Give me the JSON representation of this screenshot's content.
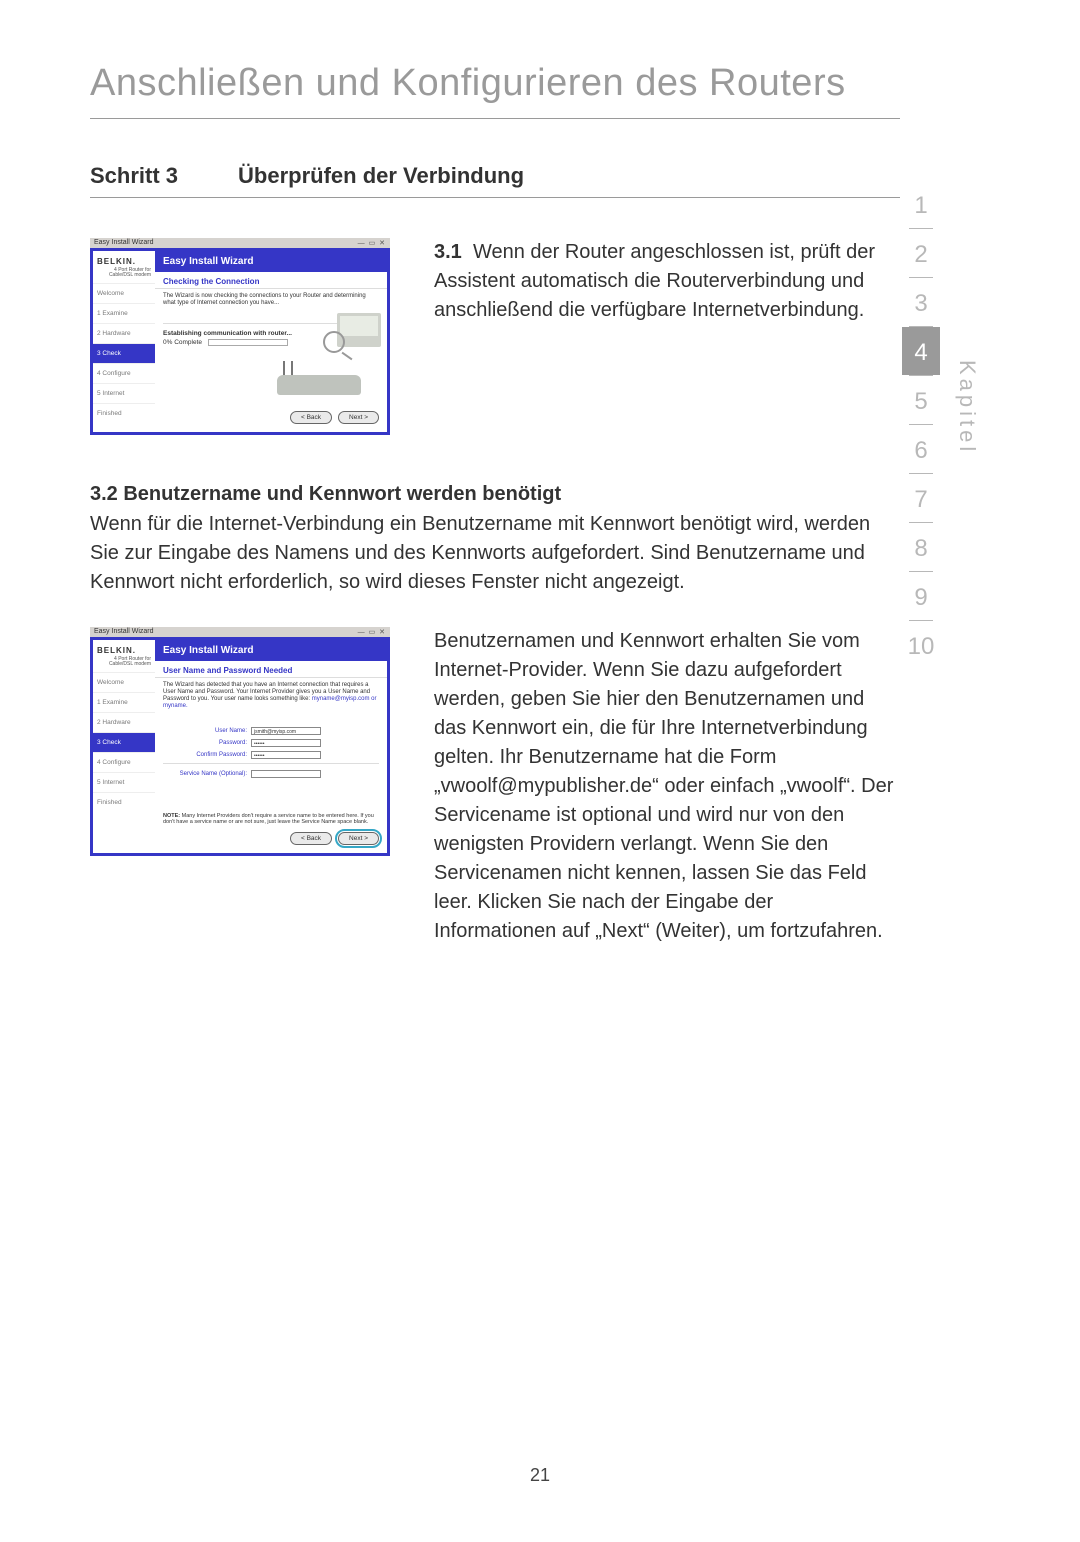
{
  "title": "Anschließen und Konfigurieren des Routers",
  "step": {
    "label": "Schritt 3",
    "name": "Überprüfen der Verbindung"
  },
  "p31": {
    "num": "3.1",
    "text": "Wenn der Router angeschlossen ist, prüft der Assistent automatisch die Routerverbindung und anschließend die verfügbare Internetverbindung."
  },
  "p32": {
    "heading": "3.2  Benutzername und Kennwort werden benötigt",
    "text": "Wenn für die Internet-Verbindung ein Benutzername mit Kennwort benötigt wird, werden Sie zur Eingabe des Namens und des Kennworts aufgefordert. Sind Benutzername und Kennwort nicht erforderlich, so wird dieses Fenster nicht angezeigt.",
    "text2": "Benutzernamen und Kennwort erhalten Sie vom Internet-Provider. Wenn Sie dazu aufgefordert werden, geben Sie hier den Benutzernamen und das Kennwort ein, die für Ihre Internetverbindung gelten. Ihr Benutzername hat die Form „vwoolf@mypublisher.de“ oder einfach „vwoolf“. Der Servicename ist optional und wird nur von den wenigsten Providern verlangt. Wenn Sie den Servicenamen nicht kennen, lassen Sie das Feld leer. Klicken Sie nach der Eingabe der Informationen auf „Next“ (Weiter), um fortzufahren."
  },
  "page_number": "21",
  "chapters": {
    "items": [
      "1",
      "2",
      "3",
      "4",
      "5",
      "6",
      "7",
      "8",
      "9",
      "10"
    ],
    "active": "4",
    "label": "Kapitel"
  },
  "wiz_common": {
    "window_title": "Easy Install Wizard",
    "logo": "BELKIN.",
    "tagline": "4 Port Router for Cable/DSL modem",
    "header": "Easy Install Wizard",
    "back": "< Back",
    "next": "Next >"
  },
  "wiz1": {
    "steps": [
      "Welcome",
      "1 Examine",
      "2 Hardware",
      "3 Check",
      "4 Configure",
      "5 Internet",
      "Finished"
    ],
    "active_step": "3 Check",
    "subhead": "Checking the Connection",
    "desc": "The Wizard is now checking the connections to your Router and determining what type of Internet connection you have...",
    "progress_label": "Establishing communication with router...",
    "progress_pct": "0% Complete"
  },
  "wiz2": {
    "steps": [
      "Welcome",
      "1 Examine",
      "2 Hardware",
      "3 Check",
      "4 Configure",
      "5 Internet",
      "Finished"
    ],
    "active_step": "3 Check",
    "subhead": "User Name and Password Needed",
    "desc_a": "The Wizard has detected that you have an Internet connection that requires a User Name and Password. Your Internet Provider gives you a User Name and Password to you. Your user name looks something like: ",
    "desc_b": "myname@myisp.com or myname.",
    "fields": {
      "user_label": "User Name:",
      "user_value": "jsmith@myisp.com",
      "pass_label": "Password:",
      "pass_value": "••••••",
      "confirm_label": "Confirm Password:",
      "confirm_value": "••••••",
      "service_label": "Service Name (Optional):",
      "service_value": ""
    },
    "note_label": "NOTE:",
    "note": " Many Internet Providers don't require a service name to be entered here. If you don't have a service name or are not sure, just leave the Service Name space blank."
  }
}
